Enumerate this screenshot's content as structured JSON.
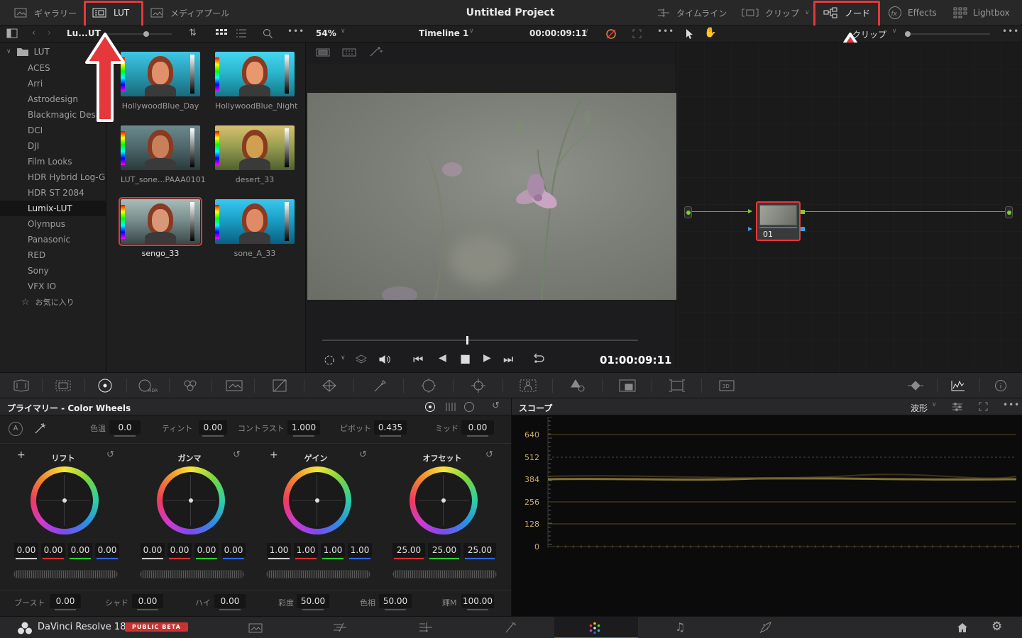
{
  "topbar": {
    "gallery": "ギャラリー",
    "lut": "LUT",
    "media_pool": "メディアプール",
    "project_title": "Untitled Project",
    "timeline": "タイムライン",
    "clips": "クリップ",
    "nodes": "ノード",
    "effects": "Effects",
    "lightbox": "Lightbox"
  },
  "subbar": {
    "lut_path": "Lu...UT",
    "zoom": "54%",
    "timeline_name": "Timeline 1",
    "timecode": "00:00:09:11",
    "node_mode": "クリップ"
  },
  "lut_tree": {
    "root": "LUT",
    "items": [
      "ACES",
      "Arri",
      "Astrodesign",
      "Blackmagic Design",
      "DCI",
      "DJI",
      "Film Looks",
      "HDR Hybrid Log-G...",
      "HDR ST 2084",
      "Lumix-LUT",
      "Olympus",
      "Panasonic",
      "RED",
      "Sony",
      "VFX IO"
    ],
    "active_index": 9,
    "favorites": "お気に入り"
  },
  "luts": [
    {
      "name": "HollywoodBlue_Day"
    },
    {
      "name": "HollywoodBlue_Night"
    },
    {
      "name": "LUT_sone...PAAA0101"
    },
    {
      "name": "desert_33"
    },
    {
      "name": "sengo_33"
    },
    {
      "name": "sone_A_33"
    }
  ],
  "viewer": {
    "timecode": "01:00:09:11"
  },
  "node": {
    "label": "01"
  },
  "primaries": {
    "title": "プライマリー - Color Wheels",
    "temp_label": "色温",
    "temp": "0.0",
    "tint_label": "ティント",
    "tint": "0.00",
    "contrast_label": "コントラスト",
    "contrast": "1.000",
    "pivot_label": "ピボット",
    "pivot": "0.435",
    "mid_label": "ミッド",
    "mid": "0.00",
    "wheels": [
      {
        "name": "リフト",
        "values": [
          "0.00",
          "0.00",
          "0.00",
          "0.00"
        ]
      },
      {
        "name": "ガンマ",
        "values": [
          "0.00",
          "0.00",
          "0.00",
          "0.00"
        ]
      },
      {
        "name": "ゲイン",
        "values": [
          "1.00",
          "1.00",
          "1.00",
          "1.00"
        ]
      },
      {
        "name": "オフセット",
        "values": [
          "25.00",
          "25.00",
          "25.00"
        ]
      }
    ],
    "boost_label": "ブースト",
    "boost": "0.00",
    "shadow_label": "シャド",
    "shadow": "0.00",
    "high_label": "ハイ",
    "high": "0.00",
    "sat_label": "彩度",
    "sat": "50.00",
    "hue_label": "色相",
    "hue": "50.00",
    "lum_label": "輝M",
    "lum": "100.00"
  },
  "scopes": {
    "title": "スコープ",
    "mode": "波形",
    "ticks": [
      "640",
      "512",
      "384",
      "256",
      "128",
      "0"
    ]
  },
  "bottom": {
    "app_name": "DaVinci Resolve 18",
    "badge": "PUBLIC BETA"
  },
  "colors": {
    "accent_red": "#e4383b",
    "badge_red": "#c8322f",
    "scope_trace": "#8a7a3a"
  }
}
